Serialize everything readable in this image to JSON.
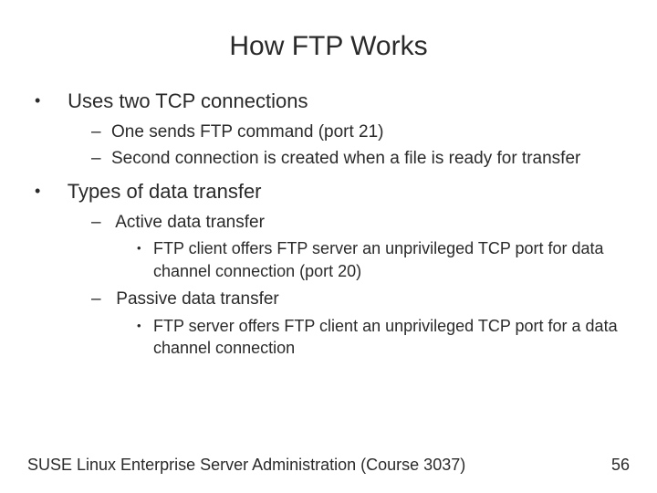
{
  "title": "How FTP Works",
  "bullets": {
    "b1": {
      "text": "Uses two TCP connections",
      "sub": {
        "s1": "One sends FTP command (port 21)",
        "s2": "Second connection is created when a file is ready for transfer"
      }
    },
    "b2": {
      "text": "Types of data transfer",
      "sub": {
        "s1": {
          "text": "Active data transfer",
          "sub": {
            "t1": "FTP client offers FTP server an unprivileged TCP port for data channel connection (port 20)"
          }
        },
        "s2": {
          "text": "Passive data transfer",
          "sub": {
            "t1": "FTP server offers FTP client an unprivileged TCP port for a data channel connection"
          }
        }
      }
    }
  },
  "footer": {
    "course": "SUSE Linux Enterprise Server Administration (Course 3037)",
    "page": "56"
  }
}
